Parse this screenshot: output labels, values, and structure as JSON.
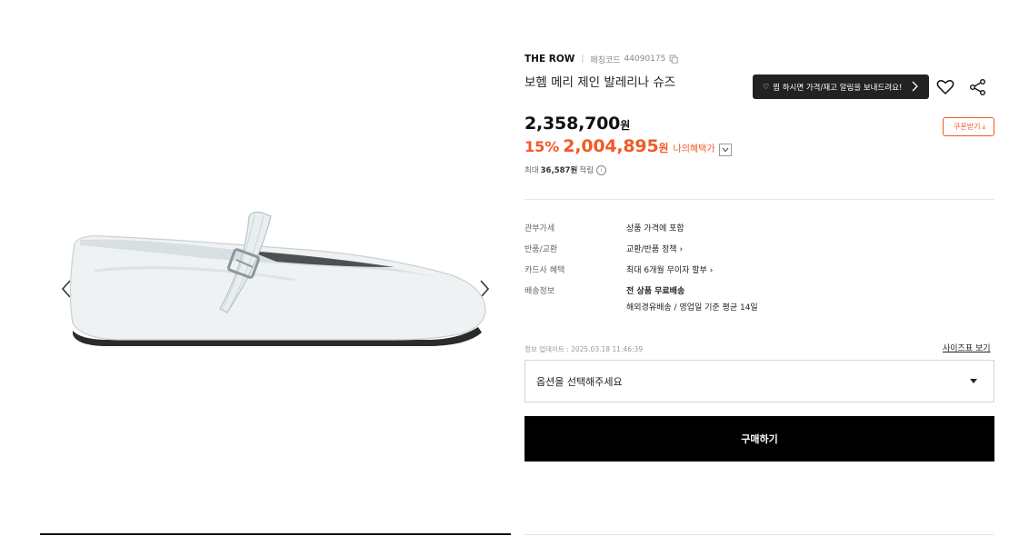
{
  "product": {
    "brand": "THE ROW",
    "code_label": "페칭코드",
    "code": "44090175",
    "name": "보헴 메리 제인 발레리나 슈즈"
  },
  "actions": {
    "price_alert_label": "찜 하시면 가격/재고 알림을 보내드려요!",
    "coupon_label": "쿠폰받기",
    "wishlist_icon": "heart-icon",
    "share_icon": "share-icon"
  },
  "pricing": {
    "original": "2,358,700",
    "unit": "원",
    "discount_pct": "15%",
    "sale": "2,004,895",
    "benefit_label": "나의혜택가",
    "points_prefix": "최대",
    "points_amount": "36,587원",
    "points_suffix": "적립",
    "accent_color": "#f15a24"
  },
  "details": [
    {
      "label": "관부가세",
      "value": "상품 가격에 포함",
      "link": false
    },
    {
      "label": "반품/교환",
      "value": "교환/반품 정책",
      "link": true
    },
    {
      "label": "카드사 혜택",
      "value": "최대 6개월 무이자 할부",
      "link": true
    },
    {
      "label": "배송정보",
      "value": "전 상품 무료배송",
      "value2": "해외경유배송 / 영업일 기준 평균 14일",
      "link": false
    }
  ],
  "meta": {
    "updated": "정보 업데이트 : 2025.03.18 11:46:39",
    "size_chart": "사이즈표 보기"
  },
  "option": {
    "placeholder": "옵션을 선택해주세요"
  },
  "buy": {
    "label": "구매하기"
  }
}
